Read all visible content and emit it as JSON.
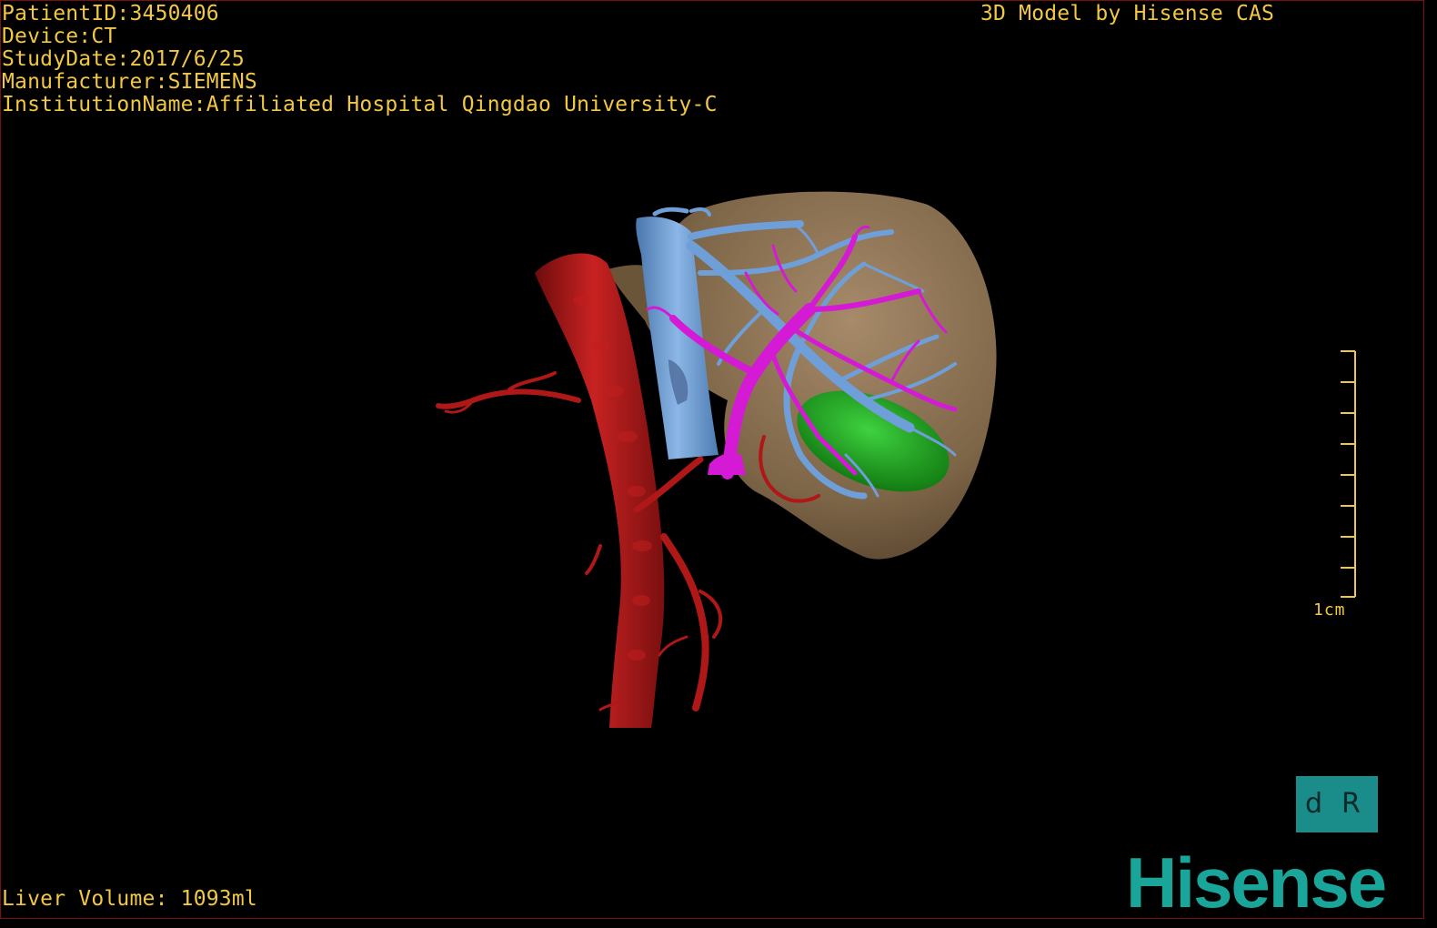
{
  "patient_info": {
    "patient_id": "PatientID:3450406",
    "device": "Device:CT",
    "study_date": "StudyDate:2017/6/25",
    "manufacturer": "Manufacturer:SIEMENS",
    "institution": "InstitutionName:Affiliated Hospital Qingdao University-C"
  },
  "header_right": "3D Model by Hisense CAS",
  "scale": {
    "label": "1cm"
  },
  "orientation": {
    "left_glyph": "d",
    "right_glyph": "R"
  },
  "liver_volume": "Liver Volume: 1093ml",
  "logo_text": "Hisense",
  "colors": {
    "overlay_text": "#f2c744",
    "liver": "#8b7355",
    "artery": "#b01818",
    "hepatic_vein": "#6f9fd8",
    "portal_vein": "#d41ad4",
    "lesion": "#1fa01f",
    "brand": "#1aa59a"
  },
  "model_structures": [
    "liver",
    "aorta",
    "hepatic-veins",
    "portal-veins",
    "lesion"
  ]
}
